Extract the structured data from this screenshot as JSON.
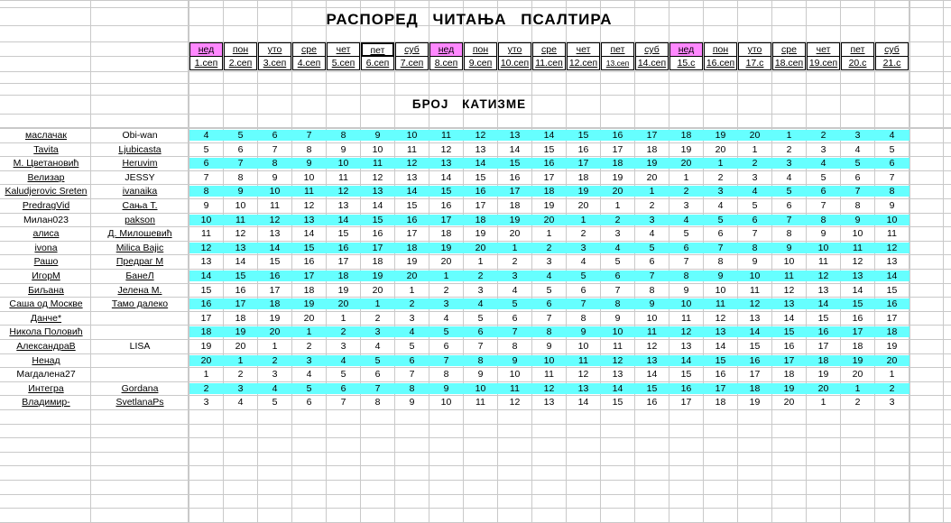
{
  "sheet": {
    "title": "РАСПОРЕД   ЧИТАЊА   ПСАЛТИРА",
    "subtitle": "БРОЈ   КАТИЗМЕ",
    "days": [
      {
        "wd": "нед",
        "date": "1.сеп",
        "pink": true
      },
      {
        "wd": "пон",
        "date": "2.сеп"
      },
      {
        "wd": "уто",
        "date": "3.сеп"
      },
      {
        "wd": "сре",
        "date": "4.сеп"
      },
      {
        "wd": "чет",
        "date": "5.сеп"
      },
      {
        "wd": "пет",
        "date": "6.сеп",
        "selected": true
      },
      {
        "wd": "суб",
        "date": "7.сеп"
      },
      {
        "wd": "нед",
        "date": "8.сеп",
        "pink": true
      },
      {
        "wd": "пон",
        "date": "9.сеп"
      },
      {
        "wd": "уто",
        "date": "10.сеп"
      },
      {
        "wd": "сре",
        "date": "11.сеп"
      },
      {
        "wd": "чет",
        "date": "12.сеп"
      },
      {
        "wd": "пет",
        "date": "13.сеп",
        "small": true
      },
      {
        "wd": "суб",
        "date": "14.сеп"
      },
      {
        "wd": "нед",
        "date": "15.с",
        "pink": true
      },
      {
        "wd": "пон",
        "date": "16.сеп"
      },
      {
        "wd": "уто",
        "date": "17.с"
      },
      {
        "wd": "сре",
        "date": "18.сеп"
      },
      {
        "wd": "чет",
        "date": "19.сеп"
      },
      {
        "wd": "пет",
        "date": "20.с"
      },
      {
        "wd": "суб",
        "date": "21.с"
      }
    ],
    "rows": [
      {
        "n1": "маслачак",
        "n2": "Obi-wan",
        "vals": [
          4,
          5,
          6,
          7,
          8,
          9,
          10,
          11,
          12,
          13,
          14,
          15,
          16,
          17,
          18,
          19,
          20,
          1,
          2,
          3,
          4
        ],
        "cyan": true,
        "u1": true
      },
      {
        "n1": "Tavita",
        "n2": "Ljubicasta",
        "vals": [
          5,
          6,
          7,
          8,
          9,
          10,
          11,
          12,
          13,
          14,
          15,
          16,
          17,
          18,
          19,
          20,
          1,
          2,
          3,
          4,
          5
        ],
        "u1": true,
        "u2": true
      },
      {
        "n1": "М. Цветановић",
        "n2": "Heruvim",
        "vals": [
          6,
          7,
          8,
          9,
          10,
          11,
          12,
          13,
          14,
          15,
          16,
          17,
          18,
          19,
          20,
          1,
          2,
          3,
          4,
          5,
          6
        ],
        "cyan": true,
        "u1": true,
        "u2": true
      },
      {
        "n1": "Велизар",
        "n2": "JESSY",
        "vals": [
          7,
          8,
          9,
          10,
          11,
          12,
          13,
          14,
          15,
          16,
          17,
          18,
          19,
          20,
          1,
          2,
          3,
          4,
          5,
          6,
          7
        ],
        "u1": true
      },
      {
        "n1": "Kaludjerovic Sreten",
        "n2": "ivanaika",
        "vals": [
          8,
          9,
          10,
          11,
          12,
          13,
          14,
          15,
          16,
          17,
          18,
          19,
          20,
          1,
          2,
          3,
          4,
          5,
          6,
          7,
          8
        ],
        "cyan": true,
        "u1": true,
        "u2": true
      },
      {
        "n1": "PredragVid",
        "n2": "Сања Т.",
        "vals": [
          9,
          10,
          11,
          12,
          13,
          14,
          15,
          16,
          17,
          18,
          19,
          20,
          1,
          2,
          3,
          4,
          5,
          6,
          7,
          8,
          9
        ],
        "u1": true,
        "u2": true
      },
      {
        "n1": "Милан023",
        "n2": "pakson",
        "vals": [
          10,
          11,
          12,
          13,
          14,
          15,
          16,
          17,
          18,
          19,
          20,
          1,
          2,
          3,
          4,
          5,
          6,
          7,
          8,
          9,
          10
        ],
        "cyan": true,
        "u2": true
      },
      {
        "n1": "алиса",
        "n2": "Д. Милошевић",
        "vals": [
          11,
          12,
          13,
          14,
          15,
          16,
          17,
          18,
          19,
          20,
          1,
          2,
          3,
          4,
          5,
          6,
          7,
          8,
          9,
          10,
          11
        ],
        "u1": true,
        "u2": true
      },
      {
        "n1": "ivona",
        "n2": "Milica Bajic",
        "vals": [
          12,
          13,
          14,
          15,
          16,
          17,
          18,
          19,
          20,
          1,
          2,
          3,
          4,
          5,
          6,
          7,
          8,
          9,
          10,
          11,
          12
        ],
        "cyan": true,
        "u1": true,
        "u2": true
      },
      {
        "n1": "Рашо",
        "n2": "Предраг М",
        "vals": [
          13,
          14,
          15,
          16,
          17,
          18,
          19,
          20,
          1,
          2,
          3,
          4,
          5,
          6,
          7,
          8,
          9,
          10,
          11,
          12,
          13
        ],
        "u1": true,
        "u2": true
      },
      {
        "n1": "ИгорМ",
        "n2": "БанеЛ",
        "vals": [
          14,
          15,
          16,
          17,
          18,
          19,
          20,
          1,
          2,
          3,
          4,
          5,
          6,
          7,
          8,
          9,
          10,
          11,
          12,
          13,
          14
        ],
        "cyan": true,
        "u1": true,
        "u2": true
      },
      {
        "n1": "Биљана",
        "n2": "Јелена М.",
        "vals": [
          15,
          16,
          17,
          18,
          19,
          20,
          1,
          2,
          3,
          4,
          5,
          6,
          7,
          8,
          9,
          10,
          11,
          12,
          13,
          14,
          15
        ],
        "u1": true,
        "u2": true
      },
      {
        "n1": "Саша од Москве",
        "n2": "Тамо далеко",
        "vals": [
          16,
          17,
          18,
          19,
          20,
          1,
          2,
          3,
          4,
          5,
          6,
          7,
          8,
          9,
          10,
          11,
          12,
          13,
          14,
          15,
          16
        ],
        "cyan": true,
        "u1": true,
        "u2": true
      },
      {
        "n1": "Данче*",
        "n2": "",
        "vals": [
          17,
          18,
          19,
          20,
          1,
          2,
          3,
          4,
          5,
          6,
          7,
          8,
          9,
          10,
          11,
          12,
          13,
          14,
          15,
          16,
          17
        ],
        "u1": true
      },
      {
        "n1": "Никола Половић",
        "n2": "",
        "vals": [
          18,
          19,
          20,
          1,
          2,
          3,
          4,
          5,
          6,
          7,
          8,
          9,
          10,
          11,
          12,
          13,
          14,
          15,
          16,
          17,
          18
        ],
        "cyan": true,
        "u1": true
      },
      {
        "n1": "АлександраВ",
        "n2": "LISA",
        "vals": [
          19,
          20,
          1,
          2,
          3,
          4,
          5,
          6,
          7,
          8,
          9,
          10,
          11,
          12,
          13,
          14,
          15,
          16,
          17,
          18,
          19
        ],
        "u1": true
      },
      {
        "n1": "Ненад",
        "n2": "",
        "vals": [
          20,
          1,
          2,
          3,
          4,
          5,
          6,
          7,
          8,
          9,
          10,
          11,
          12,
          13,
          14,
          15,
          16,
          17,
          18,
          19,
          20
        ],
        "cyan": true,
        "u1": true
      },
      {
        "n1": "Магдалена27",
        "n2": "",
        "vals": [
          1,
          2,
          3,
          4,
          5,
          6,
          7,
          8,
          9,
          10,
          11,
          12,
          13,
          14,
          15,
          16,
          17,
          18,
          19,
          20,
          1
        ]
      },
      {
        "n1": "Интегра",
        "n2": "Gordana",
        "vals": [
          2,
          3,
          4,
          5,
          6,
          7,
          8,
          9,
          10,
          11,
          12,
          13,
          14,
          15,
          16,
          17,
          18,
          19,
          20,
          1,
          2
        ],
        "cyan": true,
        "u1": true,
        "u2": true
      },
      {
        "n1": "Владимир-",
        "n2": "SvetlanaPs",
        "vals": [
          3,
          4,
          5,
          6,
          7,
          8,
          9,
          10,
          11,
          12,
          13,
          14,
          15,
          16,
          17,
          18,
          19,
          20,
          1,
          2,
          3
        ],
        "u1": true,
        "u2": true
      }
    ],
    "colors": {
      "cyan": "#66ffff",
      "sunday": "#ff88ff",
      "grid": "#c9c9c9"
    }
  }
}
